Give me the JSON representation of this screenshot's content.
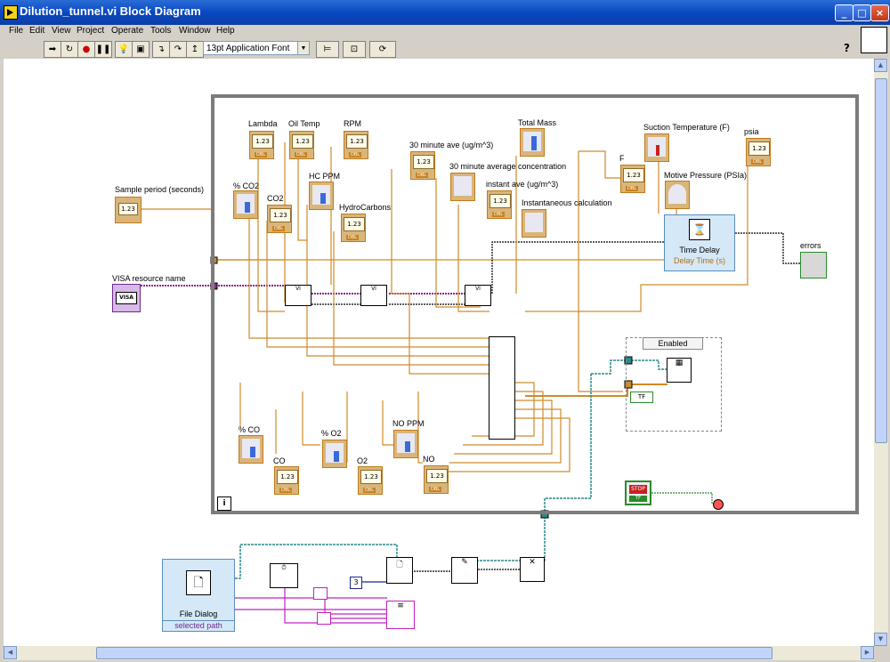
{
  "window": {
    "title": "Dilution_tunnel.vi Block Diagram"
  },
  "menu": [
    "File",
    "Edit",
    "View",
    "Project",
    "Operate",
    "Tools",
    "Window",
    "Help"
  ],
  "toolbar": {
    "font_select": "13pt Application Font",
    "help": "?"
  },
  "labels": {
    "sample_period": "Sample period (seconds)",
    "visa": "VISA resource name",
    "lambda": "Lambda",
    "oil_temp": "Oil Temp",
    "rpm": "RPM",
    "co2_pct": "% CO2",
    "co2": "CO2",
    "hc_ppm": "HC PPM",
    "hydrocarbons": "HydroCarbons",
    "thirty_min_ave": "30 minute ave (ug/m^3)",
    "total_mass": "Total Mass",
    "thirty_min_conc": "30 minute average concentration",
    "instant_ave": "instant ave (ug/m^3)",
    "instant_calc": "Instantaneous calculation",
    "suction_temp": "Suction Temperature (F)",
    "psia": "psia",
    "f": "F",
    "motive_pressure": "Motive Pressure (PSIa)",
    "time_delay": "Time Delay",
    "delay_time": "Delay Time (s)",
    "errors": "errors",
    "enabled": "Enabled",
    "co_pct": "% CO",
    "co": "CO",
    "o2_pct": "% O2",
    "o2": "O2",
    "no_ppm": "NO PPM",
    "no": "NO",
    "file_dialog": "File Dialog",
    "selected_path": "selected path"
  },
  "indicator_text": "1.23",
  "dbl": "DBL",
  "visa_text": "VISA",
  "stop_text": "STOP",
  "tf_text": "TF",
  "const_3": "3",
  "info": "i",
  "colors": {
    "orange_wire": "#d08a2a",
    "purple_wire": "#8a2a8a",
    "teal_wire": "#2a8a8a",
    "pink_wire": "#c020c0",
    "frame": "#7c7c7c"
  }
}
